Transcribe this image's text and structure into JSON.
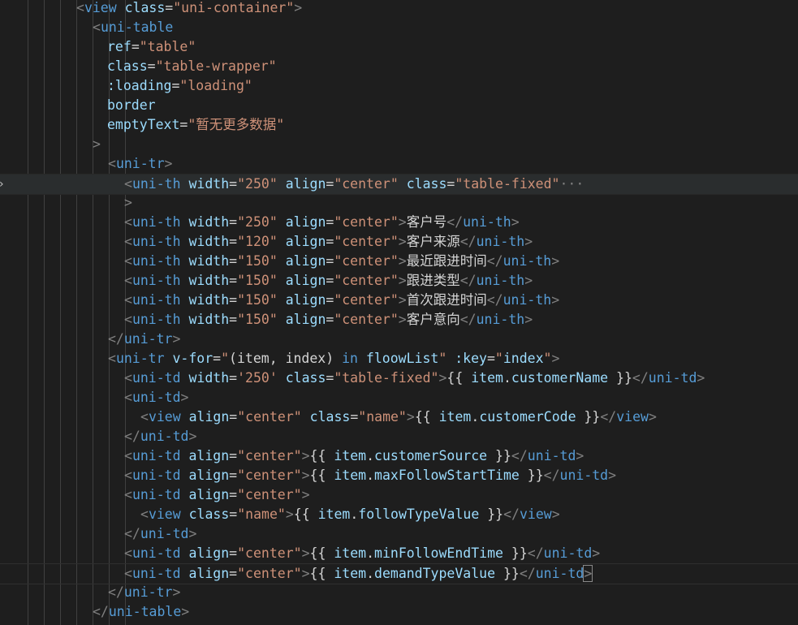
{
  "editor": {
    "theme_colors": {
      "background": "#1e1e1e",
      "tag": "#569cd6",
      "attribute": "#9cdcfe",
      "string": "#ce9178",
      "punctuation": "#808080",
      "text": "#d4d4d4"
    },
    "fold_icon": "chevron-right-icon",
    "lines": [
      {
        "tokens": [
          [
            "p",
            "<"
          ],
          [
            "tag",
            "view"
          ],
          [
            "text",
            " "
          ],
          [
            "attr",
            "class"
          ],
          [
            "text",
            "="
          ],
          [
            "str",
            "\"uni-container\""
          ],
          [
            "p",
            ">"
          ]
        ]
      },
      {
        "tokens": [
          [
            "p",
            "<"
          ],
          [
            "tag",
            "uni-table"
          ]
        ]
      },
      {
        "tokens": [
          [
            "attr",
            "ref"
          ],
          [
            "text",
            "="
          ],
          [
            "str",
            "\"table\""
          ]
        ]
      },
      {
        "tokens": [
          [
            "attr",
            "class"
          ],
          [
            "text",
            "="
          ],
          [
            "str",
            "\"table-wrapper\""
          ]
        ]
      },
      {
        "tokens": [
          [
            "attr",
            ":loading"
          ],
          [
            "text",
            "="
          ],
          [
            "str",
            "\"loading\""
          ]
        ]
      },
      {
        "tokens": [
          [
            "attr",
            "border"
          ]
        ]
      },
      {
        "tokens": [
          [
            "attr",
            "emptyText"
          ],
          [
            "text",
            "="
          ],
          [
            "str",
            "\"暂无更多数据\""
          ]
        ]
      },
      {
        "tokens": [
          [
            "p",
            ">"
          ]
        ]
      },
      {
        "tokens": [
          [
            "p",
            "<"
          ],
          [
            "tag",
            "uni-tr"
          ],
          [
            "p",
            ">"
          ]
        ]
      },
      {
        "tokens": [
          [
            "p",
            "<"
          ],
          [
            "tag",
            "uni-th"
          ],
          [
            "text",
            " "
          ],
          [
            "attr",
            "width"
          ],
          [
            "text",
            "="
          ],
          [
            "str",
            "\"250\""
          ],
          [
            "text",
            " "
          ],
          [
            "attr",
            "align"
          ],
          [
            "text",
            "="
          ],
          [
            "str",
            "\"center\""
          ],
          [
            "text",
            " "
          ],
          [
            "attr",
            "class"
          ],
          [
            "text",
            "="
          ],
          [
            "str",
            "\"table-fixed\""
          ],
          [
            "ellipsis",
            "···"
          ]
        ]
      },
      {
        "tokens": [
          [
            "p",
            ">"
          ]
        ]
      },
      {
        "tokens": [
          [
            "p",
            "<"
          ],
          [
            "tag",
            "uni-th"
          ],
          [
            "text",
            " "
          ],
          [
            "attr",
            "width"
          ],
          [
            "text",
            "="
          ],
          [
            "str",
            "\"250\""
          ],
          [
            "text",
            " "
          ],
          [
            "attr",
            "align"
          ],
          [
            "text",
            "="
          ],
          [
            "str",
            "\"center\""
          ],
          [
            "p",
            ">"
          ],
          [
            "text",
            "客户号"
          ],
          [
            "p",
            "</"
          ],
          [
            "tag",
            "uni-th"
          ],
          [
            "p",
            ">"
          ]
        ]
      },
      {
        "tokens": [
          [
            "p",
            "<"
          ],
          [
            "tag",
            "uni-th"
          ],
          [
            "text",
            " "
          ],
          [
            "attr",
            "width"
          ],
          [
            "text",
            "="
          ],
          [
            "str",
            "\"120\""
          ],
          [
            "text",
            " "
          ],
          [
            "attr",
            "align"
          ],
          [
            "text",
            "="
          ],
          [
            "str",
            "\"center\""
          ],
          [
            "p",
            ">"
          ],
          [
            "text",
            "客户来源"
          ],
          [
            "p",
            "</"
          ],
          [
            "tag",
            "uni-th"
          ],
          [
            "p",
            ">"
          ]
        ]
      },
      {
        "tokens": [
          [
            "p",
            "<"
          ],
          [
            "tag",
            "uni-th"
          ],
          [
            "text",
            " "
          ],
          [
            "attr",
            "width"
          ],
          [
            "text",
            "="
          ],
          [
            "str",
            "\"150\""
          ],
          [
            "text",
            " "
          ],
          [
            "attr",
            "align"
          ],
          [
            "text",
            "="
          ],
          [
            "str",
            "\"center\""
          ],
          [
            "p",
            ">"
          ],
          [
            "text",
            "最近跟进时间"
          ],
          [
            "p",
            "</"
          ],
          [
            "tag",
            "uni-th"
          ],
          [
            "p",
            ">"
          ]
        ]
      },
      {
        "tokens": [
          [
            "p",
            "<"
          ],
          [
            "tag",
            "uni-th"
          ],
          [
            "text",
            " "
          ],
          [
            "attr",
            "width"
          ],
          [
            "text",
            "="
          ],
          [
            "str",
            "\"150\""
          ],
          [
            "text",
            " "
          ],
          [
            "attr",
            "align"
          ],
          [
            "text",
            "="
          ],
          [
            "str",
            "\"center\""
          ],
          [
            "p",
            ">"
          ],
          [
            "text",
            "跟进类型"
          ],
          [
            "p",
            "</"
          ],
          [
            "tag",
            "uni-th"
          ],
          [
            "p",
            ">"
          ]
        ]
      },
      {
        "tokens": [
          [
            "p",
            "<"
          ],
          [
            "tag",
            "uni-th"
          ],
          [
            "text",
            " "
          ],
          [
            "attr",
            "width"
          ],
          [
            "text",
            "="
          ],
          [
            "str",
            "\"150\""
          ],
          [
            "text",
            " "
          ],
          [
            "attr",
            "align"
          ],
          [
            "text",
            "="
          ],
          [
            "str",
            "\"center\""
          ],
          [
            "p",
            ">"
          ],
          [
            "text",
            "首次跟进时间"
          ],
          [
            "p",
            "</"
          ],
          [
            "tag",
            "uni-th"
          ],
          [
            "p",
            ">"
          ]
        ]
      },
      {
        "tokens": [
          [
            "p",
            "<"
          ],
          [
            "tag",
            "uni-th"
          ],
          [
            "text",
            " "
          ],
          [
            "attr",
            "width"
          ],
          [
            "text",
            "="
          ],
          [
            "str",
            "\"150\""
          ],
          [
            "text",
            " "
          ],
          [
            "attr",
            "align"
          ],
          [
            "text",
            "="
          ],
          [
            "str",
            "\"center\""
          ],
          [
            "p",
            ">"
          ],
          [
            "text",
            "客户意向"
          ],
          [
            "p",
            "</"
          ],
          [
            "tag",
            "uni-th"
          ],
          [
            "p",
            ">"
          ]
        ]
      },
      {
        "tokens": [
          [
            "p",
            "</"
          ],
          [
            "tag",
            "uni-tr"
          ],
          [
            "p",
            ">"
          ]
        ]
      },
      {
        "tokens": [
          [
            "p",
            "<"
          ],
          [
            "tag",
            "uni-tr"
          ],
          [
            "text",
            " "
          ],
          [
            "attr",
            "v-for"
          ],
          [
            "text",
            "="
          ],
          [
            "str",
            "\""
          ],
          [
            "text",
            "(item, index) "
          ],
          [
            "kw",
            "in"
          ],
          [
            "text",
            " "
          ],
          [
            "attr",
            "floowList"
          ],
          [
            "str",
            "\""
          ],
          [
            "text",
            " "
          ],
          [
            "attr",
            ":key"
          ],
          [
            "text",
            "="
          ],
          [
            "str",
            "\""
          ],
          [
            "attr",
            "index"
          ],
          [
            "str",
            "\""
          ],
          [
            "p",
            ">"
          ]
        ]
      },
      {
        "tokens": [
          [
            "p",
            "<"
          ],
          [
            "tag",
            "uni-td"
          ],
          [
            "text",
            " "
          ],
          [
            "attr",
            "width"
          ],
          [
            "text",
            "="
          ],
          [
            "str",
            "'250'"
          ],
          [
            "text",
            " "
          ],
          [
            "attr",
            "class"
          ],
          [
            "text",
            "="
          ],
          [
            "str",
            "\"table-fixed\""
          ],
          [
            "p",
            ">"
          ],
          [
            "text",
            "{{ "
          ],
          [
            "attr",
            "item"
          ],
          [
            "text",
            "."
          ],
          [
            "attr",
            "customerName"
          ],
          [
            "text",
            " }}"
          ],
          [
            "p",
            "</"
          ],
          [
            "tag",
            "uni-td"
          ],
          [
            "p",
            ">"
          ]
        ]
      },
      {
        "tokens": [
          [
            "p",
            "<"
          ],
          [
            "tag",
            "uni-td"
          ],
          [
            "p",
            ">"
          ]
        ]
      },
      {
        "tokens": [
          [
            "p",
            "<"
          ],
          [
            "tag",
            "view"
          ],
          [
            "text",
            " "
          ],
          [
            "attr",
            "align"
          ],
          [
            "text",
            "="
          ],
          [
            "str",
            "\"center\""
          ],
          [
            "text",
            " "
          ],
          [
            "attr",
            "class"
          ],
          [
            "text",
            "="
          ],
          [
            "str",
            "\"name\""
          ],
          [
            "p",
            ">"
          ],
          [
            "text",
            "{{ "
          ],
          [
            "attr",
            "item"
          ],
          [
            "text",
            "."
          ],
          [
            "attr",
            "customerCode"
          ],
          [
            "text",
            " }}"
          ],
          [
            "p",
            "</"
          ],
          [
            "tag",
            "view"
          ],
          [
            "p",
            ">"
          ]
        ]
      },
      {
        "tokens": [
          [
            "p",
            "</"
          ],
          [
            "tag",
            "uni-td"
          ],
          [
            "p",
            ">"
          ]
        ]
      },
      {
        "tokens": [
          [
            "p",
            "<"
          ],
          [
            "tag",
            "uni-td"
          ],
          [
            "text",
            " "
          ],
          [
            "attr",
            "align"
          ],
          [
            "text",
            "="
          ],
          [
            "str",
            "\"center\""
          ],
          [
            "p",
            ">"
          ],
          [
            "text",
            "{{ "
          ],
          [
            "attr",
            "item"
          ],
          [
            "text",
            "."
          ],
          [
            "attr",
            "customerSource"
          ],
          [
            "text",
            " }}"
          ],
          [
            "p",
            "</"
          ],
          [
            "tag",
            "uni-td"
          ],
          [
            "p",
            ">"
          ]
        ]
      },
      {
        "tokens": [
          [
            "p",
            "<"
          ],
          [
            "tag",
            "uni-td"
          ],
          [
            "text",
            " "
          ],
          [
            "attr",
            "align"
          ],
          [
            "text",
            "="
          ],
          [
            "str",
            "\"center\""
          ],
          [
            "p",
            ">"
          ],
          [
            "text",
            "{{ "
          ],
          [
            "attr",
            "item"
          ],
          [
            "text",
            "."
          ],
          [
            "attr",
            "maxFollowStartTime"
          ],
          [
            "text",
            " }}"
          ],
          [
            "p",
            "</"
          ],
          [
            "tag",
            "uni-td"
          ],
          [
            "p",
            ">"
          ]
        ]
      },
      {
        "tokens": [
          [
            "p",
            "<"
          ],
          [
            "tag",
            "uni-td"
          ],
          [
            "text",
            " "
          ],
          [
            "attr",
            "align"
          ],
          [
            "text",
            "="
          ],
          [
            "str",
            "\"center\""
          ],
          [
            "p",
            ">"
          ]
        ]
      },
      {
        "tokens": [
          [
            "p",
            "<"
          ],
          [
            "tag",
            "view"
          ],
          [
            "text",
            " "
          ],
          [
            "attr",
            "class"
          ],
          [
            "text",
            "="
          ],
          [
            "str",
            "\"name\""
          ],
          [
            "p",
            ">"
          ],
          [
            "text",
            "{{ "
          ],
          [
            "attr",
            "item"
          ],
          [
            "text",
            "."
          ],
          [
            "attr",
            "followTypeValue"
          ],
          [
            "text",
            " }}"
          ],
          [
            "p",
            "</"
          ],
          [
            "tag",
            "view"
          ],
          [
            "p",
            ">"
          ]
        ]
      },
      {
        "tokens": [
          [
            "p",
            "</"
          ],
          [
            "tag",
            "uni-td"
          ],
          [
            "p",
            ">"
          ]
        ]
      },
      {
        "tokens": [
          [
            "p",
            "<"
          ],
          [
            "tag",
            "uni-td"
          ],
          [
            "text",
            " "
          ],
          [
            "attr",
            "align"
          ],
          [
            "text",
            "="
          ],
          [
            "str",
            "\"center\""
          ],
          [
            "p",
            ">"
          ],
          [
            "text",
            "{{ "
          ],
          [
            "attr",
            "item"
          ],
          [
            "text",
            "."
          ],
          [
            "attr",
            "minFollowEndTime"
          ],
          [
            "text",
            " }}"
          ],
          [
            "p",
            "</"
          ],
          [
            "tag",
            "uni-td"
          ],
          [
            "p",
            ">"
          ]
        ]
      },
      {
        "tokens": [
          [
            "p",
            "<"
          ],
          [
            "tag",
            "uni-td"
          ],
          [
            "text",
            " "
          ],
          [
            "attr",
            "align"
          ],
          [
            "text",
            "="
          ],
          [
            "str",
            "\"center\""
          ],
          [
            "p",
            ">"
          ],
          [
            "text",
            "{{ "
          ],
          [
            "attr",
            "item"
          ],
          [
            "text",
            "."
          ],
          [
            "attr",
            "demandTypeValue"
          ],
          [
            "text",
            " }}"
          ],
          [
            "p",
            "</"
          ],
          [
            "tag",
            "uni-td"
          ],
          [
            "p",
            ">"
          ]
        ]
      },
      {
        "tokens": [
          [
            "p",
            "</"
          ],
          [
            "tag",
            "uni-tr"
          ],
          [
            "p",
            ">"
          ]
        ]
      },
      {
        "tokens": [
          [
            "p",
            "</"
          ],
          [
            "tag",
            "uni-table"
          ],
          [
            "p",
            ">"
          ]
        ]
      }
    ]
  }
}
